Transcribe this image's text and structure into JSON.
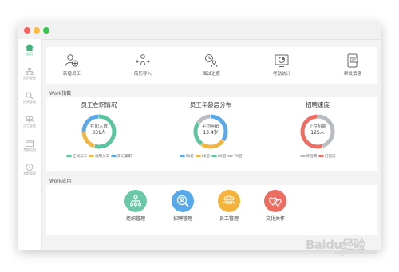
{
  "colors": {
    "accent_green": "#3bb37a",
    "ring_green": "#5cc4a1",
    "ring_yellow": "#f0b543",
    "ring_blue": "#5aa9e6",
    "ring_gray": "#b9bcc0",
    "app_teal": "#6cc9a8",
    "app_blue": "#57a9e8",
    "app_yellow": "#f3b33d",
    "app_red": "#ec6d62",
    "traffic_red": "#fc605c",
    "traffic_yellow": "#fdbc40",
    "traffic_green": "#34c84a"
  },
  "sidebar": {
    "items": [
      {
        "label": "首页",
        "icon": "home-icon",
        "active": true
      },
      {
        "label": "组织管理",
        "icon": "org-icon"
      },
      {
        "label": "招聘管理",
        "icon": "recruit-icon"
      },
      {
        "label": "员工管理",
        "icon": "employee-icon"
      },
      {
        "label": "考勤假期",
        "icon": "attendance-icon"
      },
      {
        "label": "考勤管理",
        "icon": "clock-icon"
      }
    ]
  },
  "quick_actions": [
    {
      "label": "新增员工",
      "icon": "add-user-icon"
    },
    {
      "label": "简历导入",
      "icon": "import-icon"
    },
    {
      "label": "面试进度",
      "icon": "interview-icon"
    },
    {
      "label": "考勤统计",
      "icon": "stats-icon"
    },
    {
      "label": "群发消息",
      "icon": "message-icon"
    }
  ],
  "work_index": {
    "title": "Work指数",
    "stats": [
      {
        "title": "员工在职情况",
        "center_label": "在职人数",
        "center_value": "331人",
        "segments": [
          0.55,
          0.2,
          0.25
        ],
        "segment_colors": [
          "#5cc4a1",
          "#f0b543",
          "#5aa9e6"
        ],
        "legend": [
          {
            "label": "正式员工",
            "color": "#5cc4a1"
          },
          {
            "label": "试用员工",
            "color": "#f0b543"
          },
          {
            "label": "实习兼职",
            "color": "#5aa9e6"
          }
        ]
      },
      {
        "title": "员工年龄层分布",
        "center_label": "平均年龄",
        "center_value": "13.4岁",
        "segments": [
          0.35,
          0.25,
          0.25,
          0.15
        ],
        "segment_colors": [
          "#5aa9e6",
          "#f0b543",
          "#5cc4a1",
          "#b9bcc0"
        ],
        "legend": [
          {
            "label": "90后",
            "color": "#5aa9e6"
          },
          {
            "label": "85后",
            "color": "#f0b543"
          },
          {
            "label": "80后",
            "color": "#5cc4a1"
          },
          {
            "label": "70后",
            "color": "#b9bcc0"
          }
        ]
      },
      {
        "title": "招聘速度",
        "center_label": "正在招聘",
        "center_value": "125人",
        "segments": [
          0.45,
          0.55
        ],
        "segment_colors": [
          "#b9bcc0",
          "#ec6d62"
        ],
        "legend": [
          {
            "label": "待招聘",
            "color": "#b9bcc0"
          },
          {
            "label": "已完成",
            "color": "#ec6d62"
          }
        ]
      }
    ]
  },
  "work_apps": {
    "title": "Work应用",
    "apps": [
      {
        "label": "组织管理",
        "icon": "org-tree-icon",
        "color": "#6cc9a8"
      },
      {
        "label": "招聘管理",
        "icon": "search-user-icon",
        "color": "#57a9e8"
      },
      {
        "label": "员工管理",
        "icon": "group-icon",
        "color": "#f3b33d"
      },
      {
        "label": "文化关怀",
        "icon": "hearts-icon",
        "color": "#ec6d62"
      }
    ]
  },
  "watermark": {
    "logo_text": "Baidu经验",
    "sub_text": "jingyan.baidu.com"
  }
}
